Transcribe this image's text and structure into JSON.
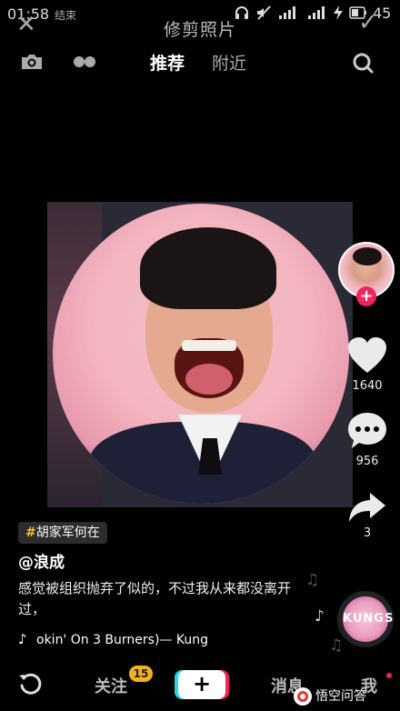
{
  "status_bar": {
    "time": "01:58",
    "overlay_text": "结束",
    "battery": "45"
  },
  "crop_header": {
    "title": "修剪照片",
    "close_icon": "close-icon",
    "confirm_icon": "check-icon"
  },
  "feed_nav": {
    "tabs": [
      {
        "label": "推荐",
        "active": true
      },
      {
        "label": "附近",
        "active": false
      }
    ],
    "icons": [
      "camera-icon",
      "dots-icon",
      "search-icon"
    ]
  },
  "rail": {
    "likes": "1640",
    "comments": "956",
    "shares": "3",
    "follow_symbol": "+"
  },
  "caption": {
    "topic_hash": "#",
    "topic": "胡家军何在",
    "author": "@浪成",
    "description": "感觉被组织抛弃了似的，不过我从来都没离开过，",
    "music_note": "♪",
    "music": "okin' On 3 Burners)— Kung"
  },
  "music_disc": {
    "label": "KUNGS"
  },
  "bottom_nav": {
    "items": [
      "关注",
      "消息",
      "我"
    ],
    "badge": "15",
    "create_symbol": "+"
  },
  "watermark": {
    "text": "悟空问答"
  },
  "colors": {
    "accent_red": "#f0245a",
    "accent_cyan": "#20d5ec",
    "badge_yellow": "#f6b11d"
  }
}
